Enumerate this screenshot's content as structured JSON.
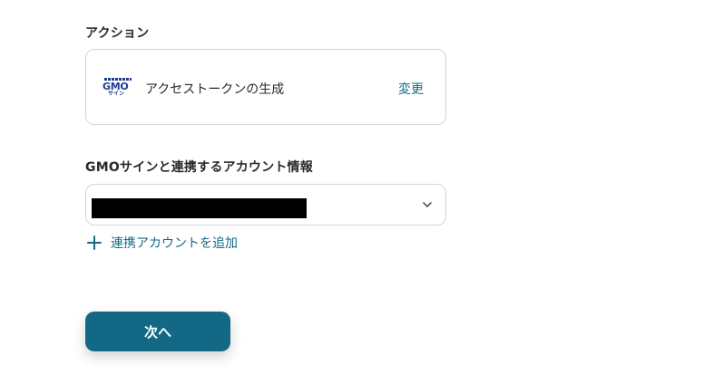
{
  "action_section": {
    "label": "アクション",
    "action_name": "アクセストークンの生成",
    "change_label": "変更",
    "logo": {
      "brand": "GMO",
      "sub": "サイン"
    }
  },
  "account_section": {
    "label": "GMOサインと連携するアカウント情報",
    "selected_value": "",
    "add_account_label": "連携アカウントを追加"
  },
  "next_button_label": "次へ",
  "colors": {
    "accent": "#136985",
    "link": "#146a84",
    "border": "#d4d6d9"
  },
  "icons": {
    "dropdown": "chevron-down-icon",
    "add": "plus-icon"
  }
}
